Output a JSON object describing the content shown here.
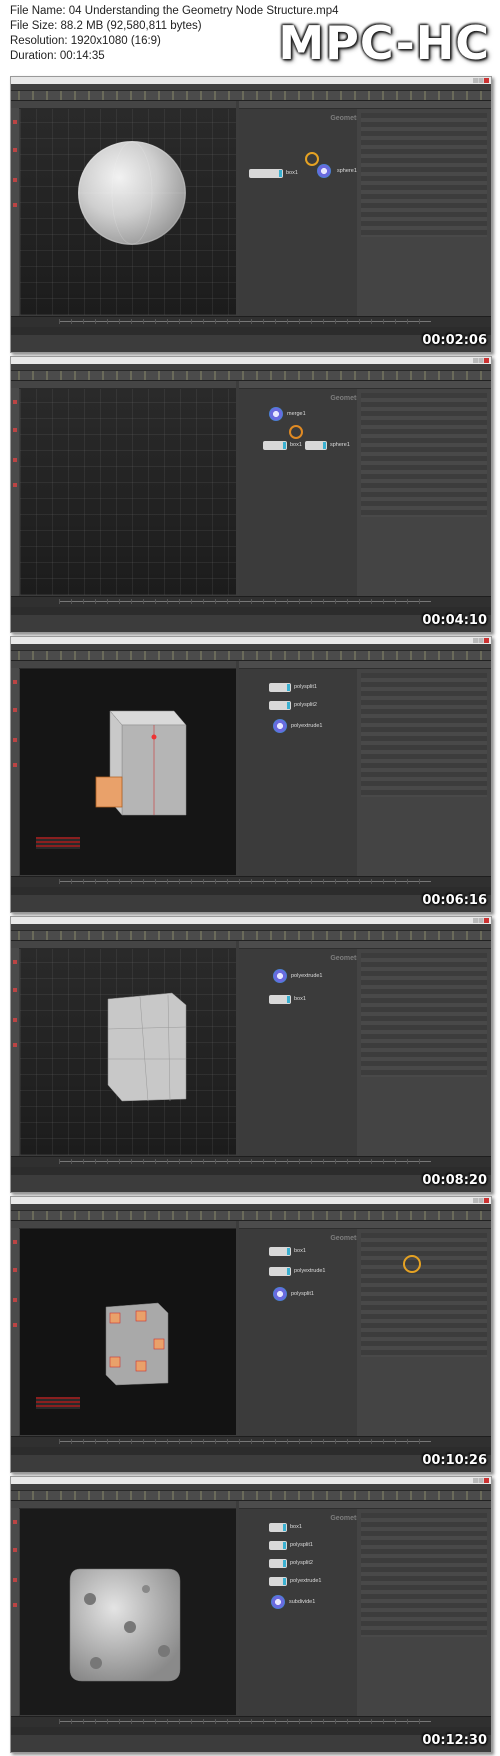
{
  "file_info": {
    "name": "File Name: 04 Understanding the Geometry Node Structure.mp4",
    "size": "File Size: 88.2 MB (92,580,811 bytes)",
    "resolution": "Resolution: 1920x1080 (16:9)",
    "duration": "Duration: 00:14:35"
  },
  "logo": "MPC-HC",
  "frames": [
    {
      "timestamp": "00:02:06",
      "network_label": "Geometry",
      "nodes": [
        "box1",
        "sphere1"
      ]
    },
    {
      "timestamp": "00:04:10",
      "network_label": "Geometry",
      "nodes": [
        "merge1",
        "box1",
        "sphere1"
      ]
    },
    {
      "timestamp": "00:06:16",
      "network_label": "Geometry",
      "nodes": [
        "polysplit1",
        "polysplit2",
        "polyextrude1"
      ]
    },
    {
      "timestamp": "00:08:20",
      "network_label": "Geometry",
      "nodes": [
        "polyextrude1",
        "box1"
      ]
    },
    {
      "timestamp": "00:10:26",
      "network_label": "Geometry",
      "nodes": [
        "box1",
        "polyextrude1",
        "polysplit1"
      ]
    },
    {
      "timestamp": "00:12:30",
      "network_label": "Geometry",
      "nodes": [
        "box1",
        "polysplit1",
        "polysplit2",
        "polyextrude1",
        "subdivide1"
      ]
    }
  ],
  "colors": {
    "viewport_bg": "#1f1f1f",
    "pane_bg": "#3a3a3a",
    "node_flag": "#3ab0d0",
    "handle": "#e5a223",
    "extrude_face": "#e9a16a"
  }
}
